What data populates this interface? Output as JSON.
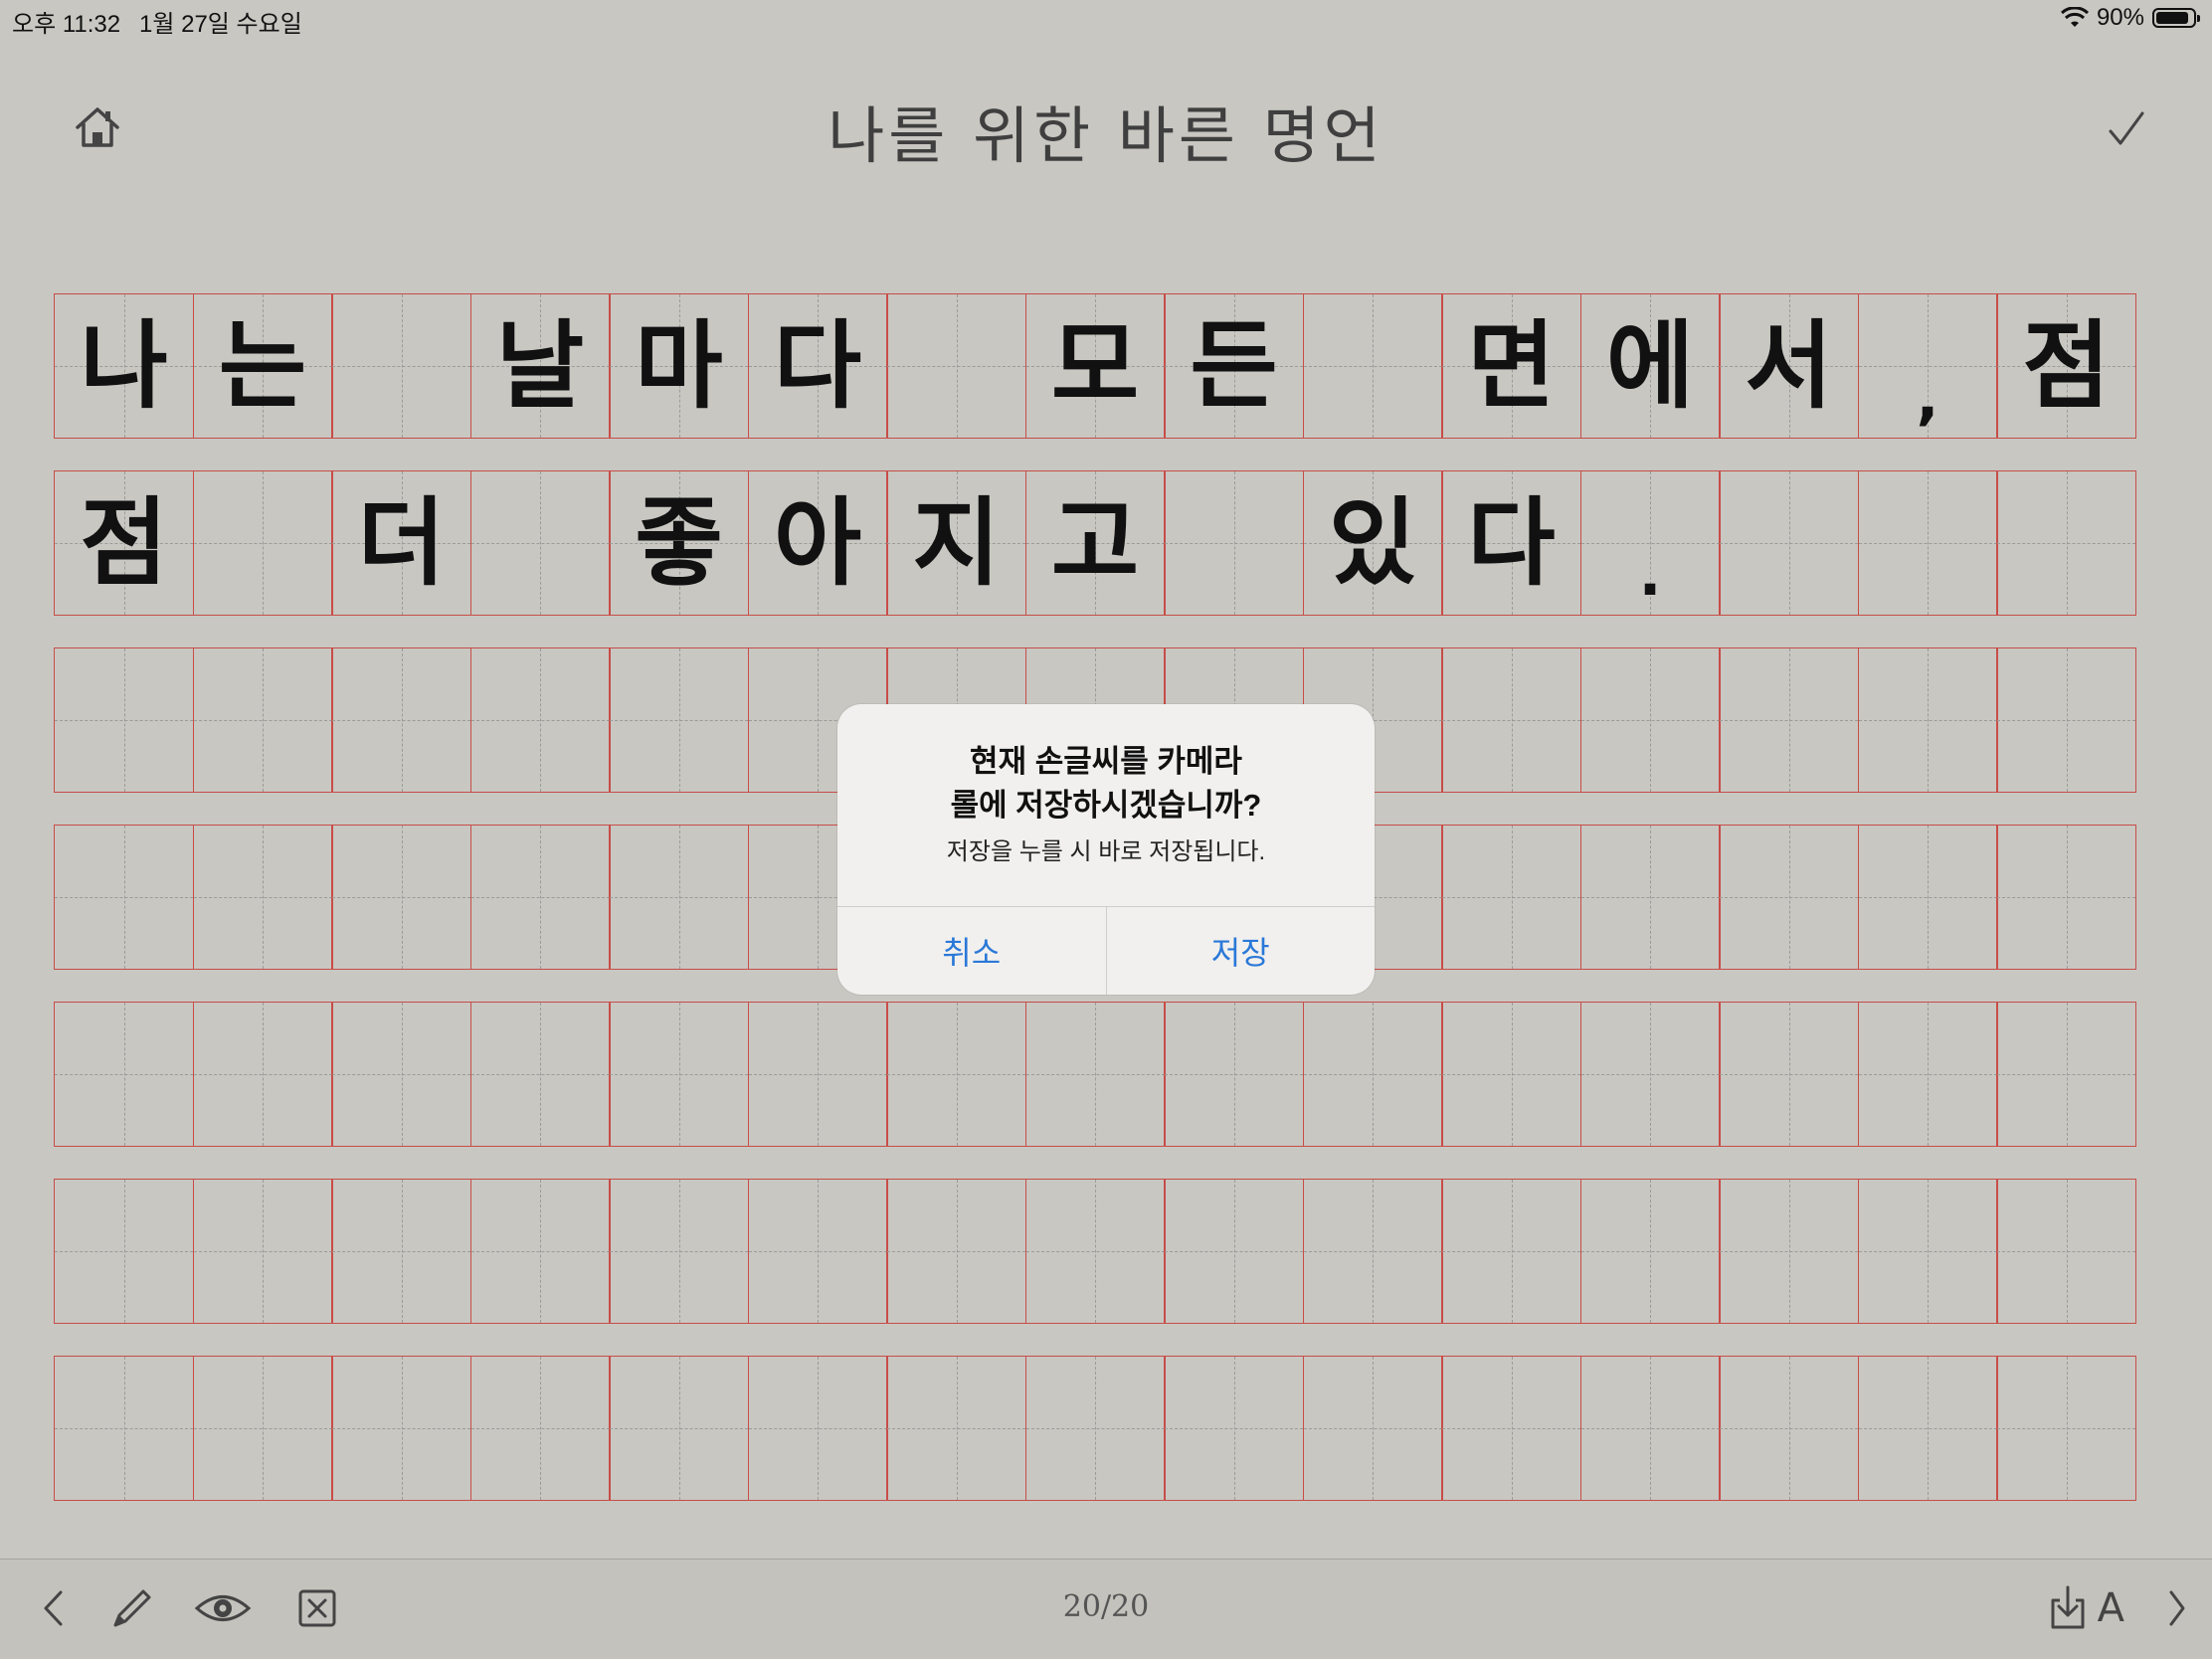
{
  "status": {
    "time": "오후 11:32",
    "date": "1월 27일 수요일",
    "battery": "90%",
    "battery_level": 0.9
  },
  "header": {
    "title": "나를 위한 바른 명언"
  },
  "grid": {
    "columns": 15,
    "rows": [
      [
        "나",
        "는",
        "",
        "날",
        "마",
        "다",
        "",
        "모",
        "든",
        "",
        "면",
        "에",
        "서",
        ",",
        "점"
      ],
      [
        "점",
        "",
        "더",
        "",
        "좋",
        "아",
        "지",
        "고",
        "",
        "있",
        "다",
        ".",
        "",
        "",
        ""
      ],
      [
        "",
        "",
        "",
        "",
        "",
        "",
        "",
        "",
        "",
        "",
        "",
        "",
        "",
        "",
        ""
      ],
      [
        "",
        "",
        "",
        "",
        "",
        "",
        "",
        "",
        "",
        "",
        "",
        "",
        "",
        "",
        ""
      ],
      [
        "",
        "",
        "",
        "",
        "",
        "",
        "",
        "",
        "",
        "",
        "",
        "",
        "",
        "",
        ""
      ],
      [
        "",
        "",
        "",
        "",
        "",
        "",
        "",
        "",
        "",
        "",
        "",
        "",
        "",
        "",
        ""
      ],
      [
        "",
        "",
        "",
        "",
        "",
        "",
        "",
        "",
        "",
        "",
        "",
        "",
        "",
        "",
        ""
      ]
    ]
  },
  "toolbar": {
    "page_indicator": "20/20",
    "font_label": "A",
    "icons": [
      "chevron-left-icon",
      "pencil-icon",
      "eye-icon",
      "clear-box-icon",
      "download-icon",
      "font-icon",
      "chevron-right-icon"
    ]
  },
  "dialog": {
    "title_line1": "현재 손글씨를 카메라",
    "title_line2": "롤에 저장하시겠습니까?",
    "message": "저장을 누를 시 바로 저장됩니다.",
    "cancel_label": "취소",
    "save_label": "저장",
    "accent_color": "#2a78d8"
  }
}
